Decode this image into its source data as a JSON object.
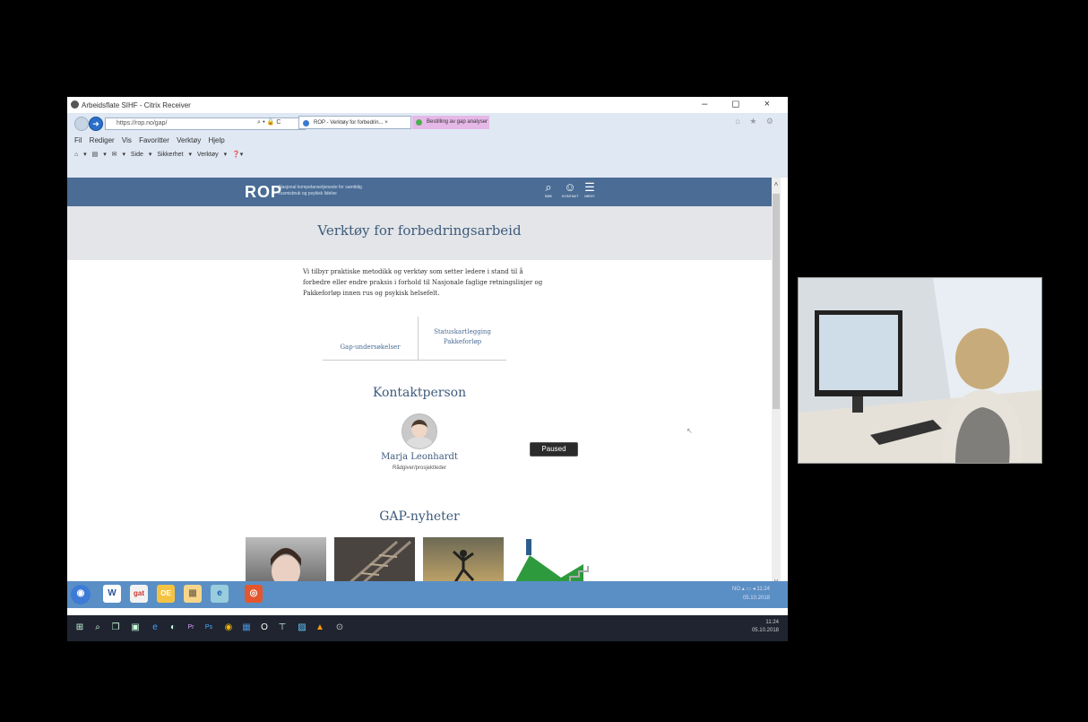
{
  "window": {
    "title": "Arbeidsflate SIHF - Citrix Receiver",
    "controls": "– ◻ ×"
  },
  "browser": {
    "url": "https://rop.no/gap/",
    "addr_tools": "⌕ ▾ 🔒 C",
    "tabs": [
      {
        "label": "ROP - Verktøy for forbedrin... ×",
        "active": true
      },
      {
        "label": "Bestilling av gap analyser",
        "active": false
      }
    ],
    "menu": "Fil  Rediger  Vis  Favoritter  Verktøy  Hjelp",
    "commandbar": "⌂ ▾ ▤ ▾ ✉ ▾ Side ▾ Sikkerhet ▾ Verktøy ▾ ❓▾",
    "tools_icons": "⌂ ★ ⚙"
  },
  "site": {
    "logo": "ROP",
    "tagline": "Nasjonal kompetansetjeneste for samtidig rusmisbruk og psykisk lidelse",
    "header_icons": [
      {
        "glyph": "⌕",
        "label": "SØK",
        "icon": "search-icon"
      },
      {
        "glyph": "☺",
        "label": "KONTAKT",
        "icon": "contact-icon"
      },
      {
        "glyph": "☰",
        "label": "MENY",
        "icon": "menu-icon"
      }
    ],
    "page_title": "Verktøy for forbedringsarbeid",
    "intro": "Vi tilbyr praktiske metodikk og verktøy som setter ledere i stand til å forbedre eller endre praksis i forhold til Nasjonale faglige retningslinjer og Pakkeforløp innen rus og psykisk helsefelt.",
    "tabs": [
      {
        "label": "Gap-undersøkelser"
      },
      {
        "label": "Statuskartlegging Pakkeforløp"
      }
    ],
    "contact_heading": "Kontaktperson",
    "contact_name": "Marja Leonhardt",
    "contact_role": "Rådgiver/prosjektleder",
    "news_heading": "GAP-nyheter"
  },
  "video": {
    "paused_label": "Paused"
  },
  "citrix_taskbar": {
    "apps": [
      "W",
      "gat",
      "OE",
      "▦",
      "e",
      "◎"
    ],
    "tray_time": "11:24",
    "tray_date": "05.10.2018",
    "lang": "NO"
  },
  "win_taskbar": {
    "time": "11:24",
    "date": "05.10.2018",
    "icons": [
      "⊞",
      "⌕",
      "❐",
      "▣",
      "e",
      "◐",
      "Pr",
      "Ps",
      "◉",
      "▦",
      "O",
      "⊤",
      "▨",
      "▲",
      "⊙"
    ]
  },
  "colors": {
    "header_blue": "#4a6c95",
    "heading_blue": "#3e5a7c"
  }
}
